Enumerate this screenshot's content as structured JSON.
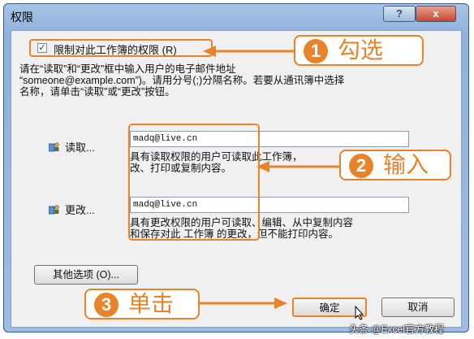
{
  "dialog": {
    "title": "权限",
    "help_label": "?",
    "close_label": "x"
  },
  "restrict": {
    "checked": true,
    "check_mark": "✓",
    "label": "限制对此工作簿的权限 (R)"
  },
  "instructions": {
    "line1": "请在“读取”和“更改”框中输入用户的电子邮件地址",
    "line2": "“someone@example.com”)。请用分号(;)分隔名称。若要从通讯簿中选择",
    "line3": "名称，请单击“读取”或“更改”按钮。"
  },
  "read": {
    "label": "读取...",
    "email": "madq@live.cn",
    "desc_line1": "具有读取权限的用户可读取此工作簿，",
    "desc_line2": "改、打印或复制内容。"
  },
  "change": {
    "label": "更改...",
    "email": "madq@live.cn",
    "desc_line1": "具有更改权限的用户可读取、编辑、从中复制内容",
    "desc_line2": "和保存对此 工作簿 的更改，但不能打印内容。"
  },
  "buttons": {
    "more_options": "其他选项 (O)...",
    "ok": "确定",
    "cancel": "取消"
  },
  "callouts": [
    {
      "number": "1",
      "text": "勾选"
    },
    {
      "number": "2",
      "text": "输入"
    },
    {
      "number": "3",
      "text": "单击"
    }
  ],
  "watermark": "头条 @Excel官方教程",
  "colors": {
    "accent": "#e8832a",
    "title_bar": "#9fbde3",
    "close_button": "#c8472d"
  }
}
